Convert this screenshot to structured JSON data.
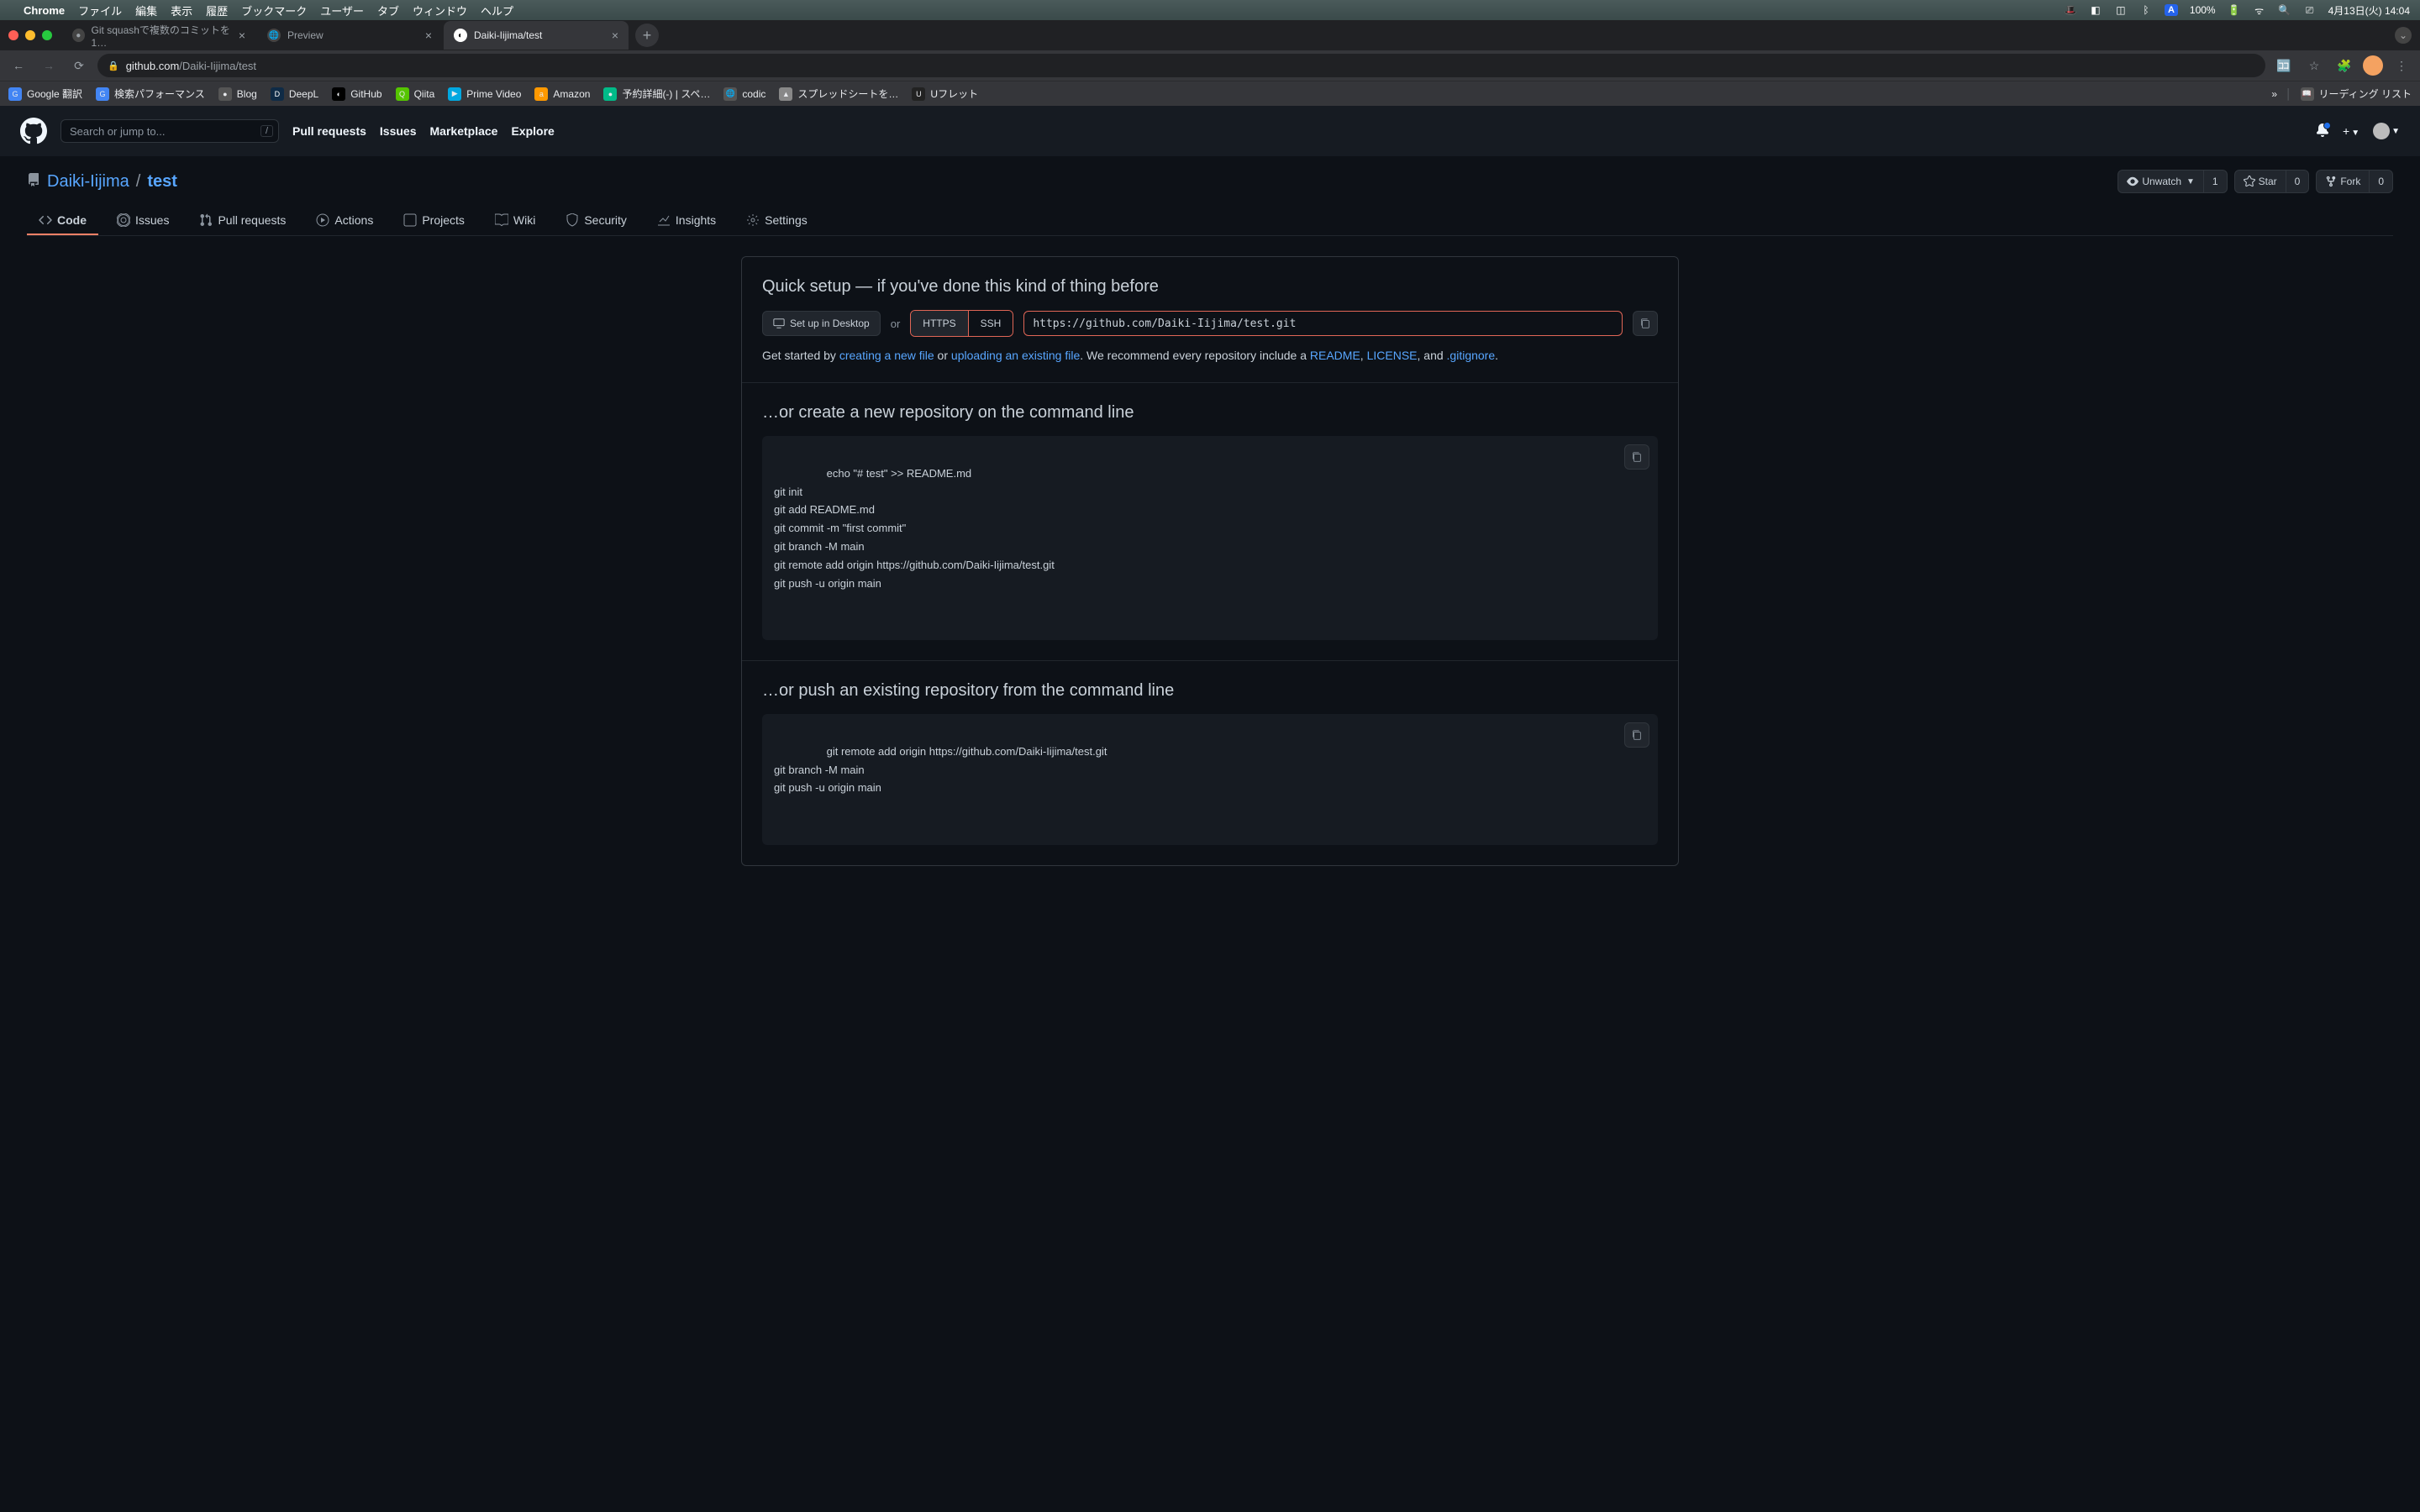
{
  "menubar": {
    "apple": "",
    "app": "Chrome",
    "items": [
      "ファイル",
      "編集",
      "表示",
      "履歴",
      "ブックマーク",
      "ユーザー",
      "タブ",
      "ウィンドウ",
      "ヘルプ"
    ],
    "battery": "100%",
    "ime": "A",
    "datetime": "4月13日(火) 14:04"
  },
  "tabs": [
    {
      "title": "Git squashで複数のコミットを1…",
      "active": false
    },
    {
      "title": "Preview",
      "active": false
    },
    {
      "title": "Daiki-Iijima/test",
      "active": true
    }
  ],
  "url": {
    "domain": "github.com",
    "path": "/Daiki-Iijima/test"
  },
  "bookmarks": [
    "Google 翻訳",
    "検索パフォーマンス",
    "Blog",
    "DeepL",
    "GitHub",
    "Qiita",
    "Prime Video",
    "Amazon",
    "予約詳細(-) | スペ…",
    "codic",
    "スプレッドシートを…",
    "Uフレット"
  ],
  "bookmore": "»",
  "reading": "リーディング リスト",
  "gh": {
    "search_ph": "Search or jump to...",
    "slash": "/",
    "nav": [
      "Pull requests",
      "Issues",
      "Marketplace",
      "Explore"
    ]
  },
  "repo": {
    "owner": "Daiki-Iijima",
    "name": "test",
    "unwatch": "Unwatch",
    "unwatch_n": "1",
    "star": "Star",
    "star_n": "0",
    "fork": "Fork",
    "fork_n": "0",
    "tabs": [
      "Code",
      "Issues",
      "Pull requests",
      "Actions",
      "Projects",
      "Wiki",
      "Security",
      "Insights",
      "Settings"
    ]
  },
  "qs": {
    "title": "Quick setup — if you've done this kind of thing before",
    "desktop": "Set up in Desktop",
    "or": "or",
    "https": "HTTPS",
    "ssh": "SSH",
    "url": "https://github.com/Daiki-Iijima/test.git",
    "help_pre": "Get started by ",
    "create": "creating a new file",
    "or2": " or ",
    "upload": "uploading an existing file",
    "help_mid": ". We recommend every repository include a ",
    "readme": "README",
    "c1": ", ",
    "license": "LICENSE",
    "c2": ", and ",
    "gitignore": ".gitignore",
    "end": "."
  },
  "create": {
    "title": "…or create a new repository on the command line",
    "code": "echo \"# test\" >> README.md\ngit init\ngit add README.md\ngit commit -m \"first commit\"\ngit branch -M main\ngit remote add origin https://github.com/Daiki-Iijima/test.git\ngit push -u origin main"
  },
  "push": {
    "title": "…or push an existing repository from the command line",
    "code": "git remote add origin https://github.com/Daiki-Iijima/test.git\ngit branch -M main\ngit push -u origin main"
  }
}
